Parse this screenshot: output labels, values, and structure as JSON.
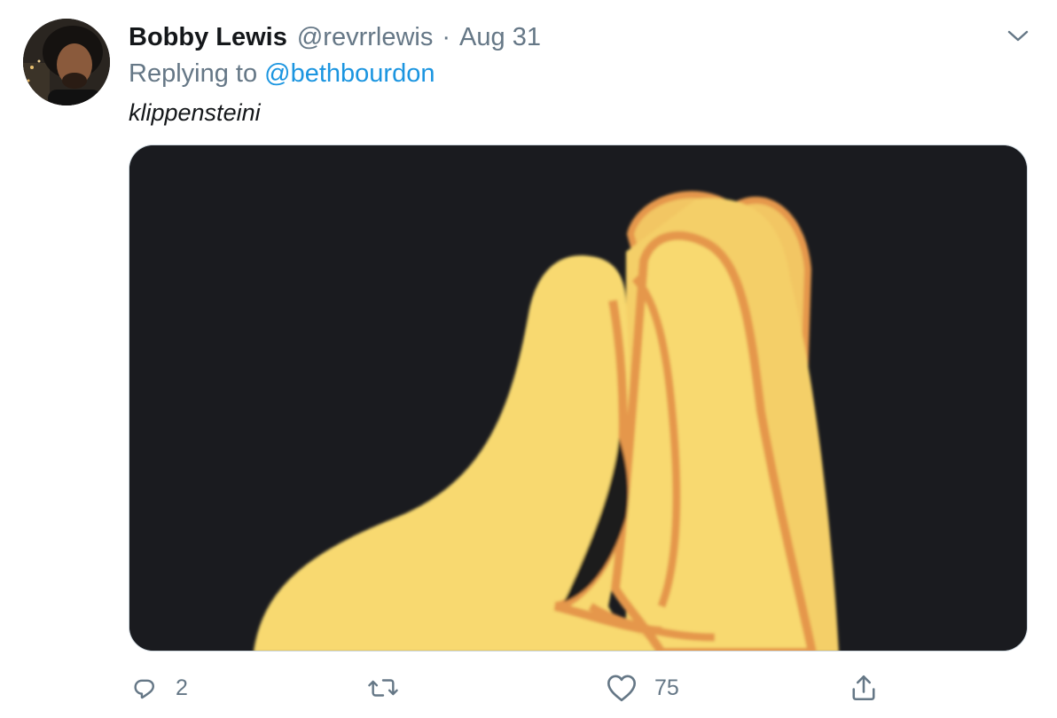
{
  "tweet": {
    "display_name": "Bobby Lewis",
    "handle": "@revrrlewis",
    "separator": "·",
    "timestamp": "Aug 31",
    "replying_prefix": "Replying to",
    "replying_to": "@bethbourdon",
    "text": "klippensteini",
    "media_description": "pinched-fingers hand emoji",
    "actions": {
      "reply_count": "2",
      "retweet_count": "",
      "like_count": "75"
    }
  },
  "colors": {
    "link": "#1b95e0",
    "secondary_text": "#657786",
    "primary_text": "#14171a",
    "media_background": "#1a1b1f",
    "hand_fill": "#f8d96f",
    "hand_outline": "#e5974c"
  },
  "icons": {
    "reply": "reply-bubble-icon",
    "retweet": "retweet-icon",
    "like": "heart-icon",
    "share": "share-upload-icon",
    "menu": "chevron-down-icon"
  }
}
